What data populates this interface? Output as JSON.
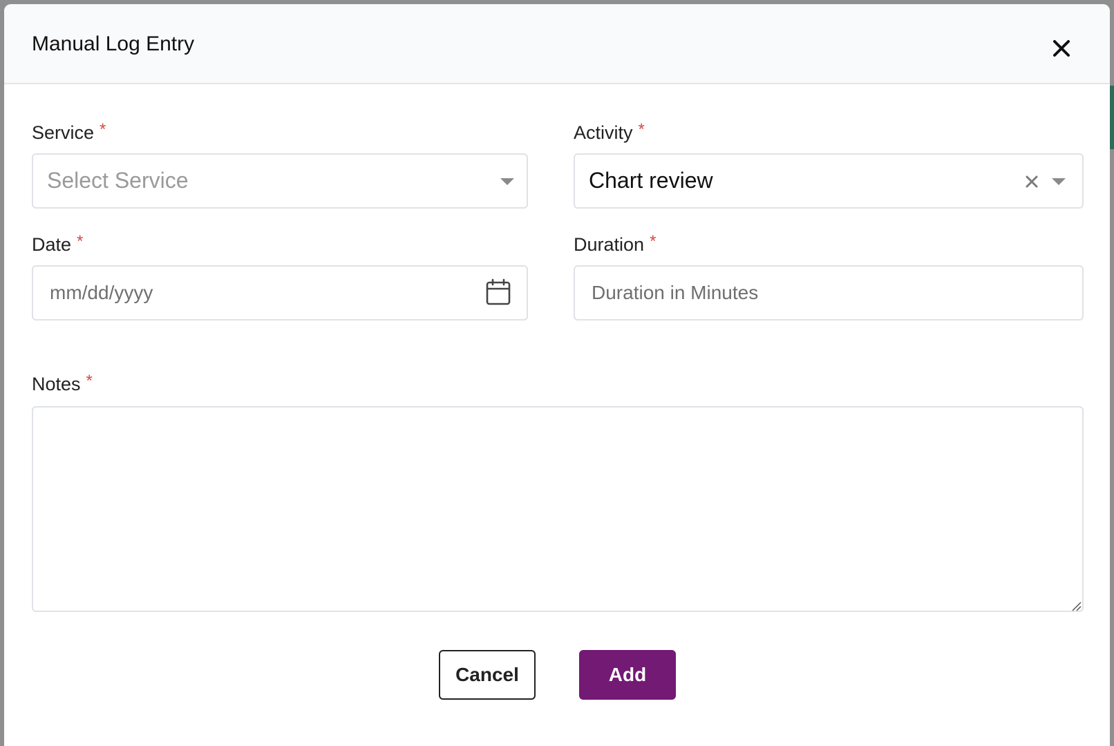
{
  "modal": {
    "title": "Manual Log Entry",
    "close_icon": "close-icon"
  },
  "form": {
    "required_marker": "*",
    "service": {
      "label": "Service",
      "placeholder": "Select Service",
      "value": ""
    },
    "activity": {
      "label": "Activity",
      "value": "Chart review"
    },
    "date": {
      "label": "Date",
      "placeholder": "mm/dd/yyyy",
      "icon": "calendar-icon"
    },
    "duration": {
      "label": "Duration",
      "placeholder": "Duration in Minutes"
    },
    "notes": {
      "label": "Notes",
      "value": ""
    }
  },
  "actions": {
    "cancel_label": "Cancel",
    "add_label": "Add"
  },
  "colors": {
    "primary": "#731a74",
    "required": "#d24a43",
    "header_bg": "#f9fafb",
    "border": "#dfe2e6"
  }
}
